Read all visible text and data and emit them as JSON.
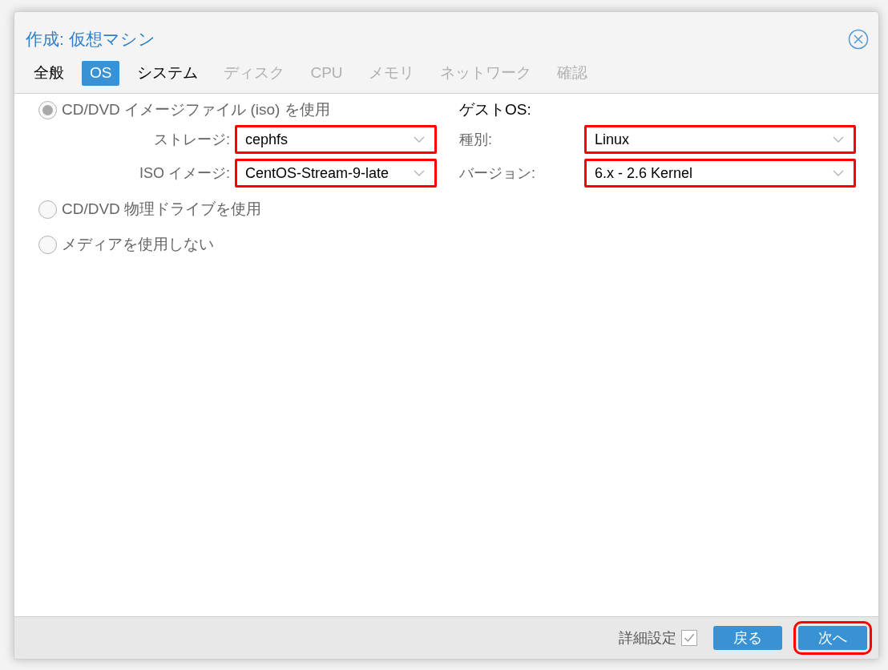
{
  "window": {
    "title": "作成: 仮想マシン"
  },
  "tabs": [
    {
      "label": "全般",
      "selected": false,
      "disabled": false
    },
    {
      "label": "OS",
      "selected": true,
      "disabled": false
    },
    {
      "label": "システム",
      "selected": false,
      "disabled": false
    },
    {
      "label": "ディスク",
      "selected": false,
      "disabled": true
    },
    {
      "label": "CPU",
      "selected": false,
      "disabled": true
    },
    {
      "label": "メモリ",
      "selected": false,
      "disabled": true
    },
    {
      "label": "ネットワーク",
      "selected": false,
      "disabled": true
    },
    {
      "label": "確認",
      "selected": false,
      "disabled": true
    }
  ],
  "media": {
    "options": [
      {
        "label": "CD/DVD イメージファイル (iso) を使用",
        "selected": true,
        "fields": [
          {
            "label": "ストレージ:",
            "value": "cephfs",
            "highlighted": true
          },
          {
            "label": "ISO イメージ:",
            "value": "CentOS-Stream-9-late",
            "highlighted": true
          }
        ]
      },
      {
        "label": "CD/DVD 物理ドライブを使用",
        "selected": false
      },
      {
        "label": "メディアを使用しない",
        "selected": false
      }
    ]
  },
  "guest_os": {
    "heading": "ゲストOS:",
    "fields": [
      {
        "label": "種別:",
        "value": "Linux",
        "highlighted": true
      },
      {
        "label": "バージョン:",
        "value": "6.x - 2.6 Kernel",
        "highlighted": true
      }
    ]
  },
  "footer": {
    "advanced": {
      "label": "詳細設定",
      "checked": true
    },
    "buttons": [
      {
        "label": "戻る",
        "highlighted": false
      },
      {
        "label": "次へ",
        "highlighted": true
      }
    ]
  }
}
